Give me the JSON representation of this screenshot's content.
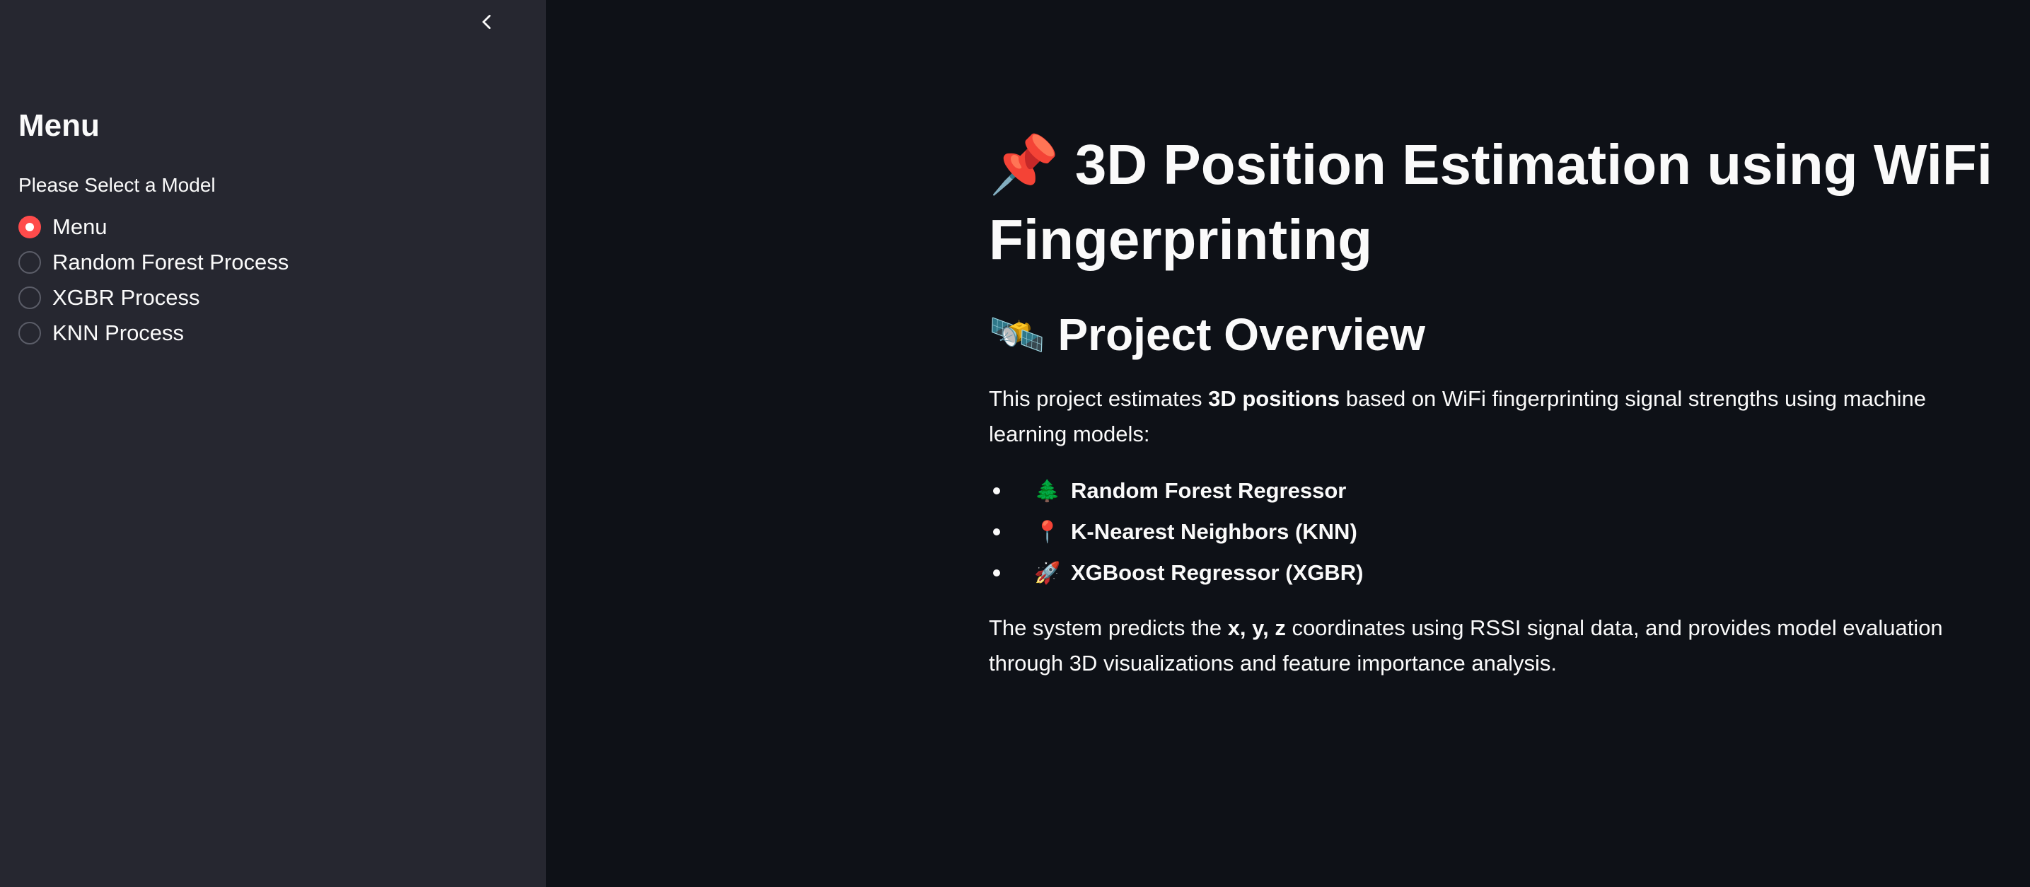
{
  "sidebar": {
    "collapse_icon": "chevron-left-icon",
    "title": "Menu",
    "radio_label": "Please Select a Model",
    "options": [
      {
        "label": "Menu",
        "selected": true
      },
      {
        "label": "Random Forest Process",
        "selected": false
      },
      {
        "label": "XGBR Process",
        "selected": false
      },
      {
        "label": "KNN Process",
        "selected": false
      }
    ]
  },
  "main": {
    "title_emoji": "📌",
    "title": "3D Position Estimation using WiFi Fingerprinting",
    "overview_emoji": "🛰️",
    "overview_heading": "Project Overview",
    "intro": {
      "before": "This project estimates ",
      "bold": "3D positions",
      "after": " based on WiFi fingerprinting signal strengths using machine learning models:"
    },
    "models": [
      {
        "icon": "🌲",
        "icon_name": "tree-icon",
        "label": "Random Forest Regressor"
      },
      {
        "icon": "📍",
        "icon_name": "round-pushpin-icon",
        "label": "K-Nearest Neighbors (KNN)"
      },
      {
        "icon": "🚀",
        "icon_name": "rocket-icon",
        "label": "XGBoost Regressor (XGBR)"
      }
    ],
    "summary": {
      "before": "The system predicts the ",
      "bold": "x, y, z",
      "after": " coordinates using RSSI signal data, and provides model evaluation through 3D visualizations and feature importance analysis."
    }
  },
  "colors": {
    "background": "#0e1117",
    "sidebar_background": "#262730",
    "accent": "#ff4b4b",
    "text": "#fafafa"
  }
}
